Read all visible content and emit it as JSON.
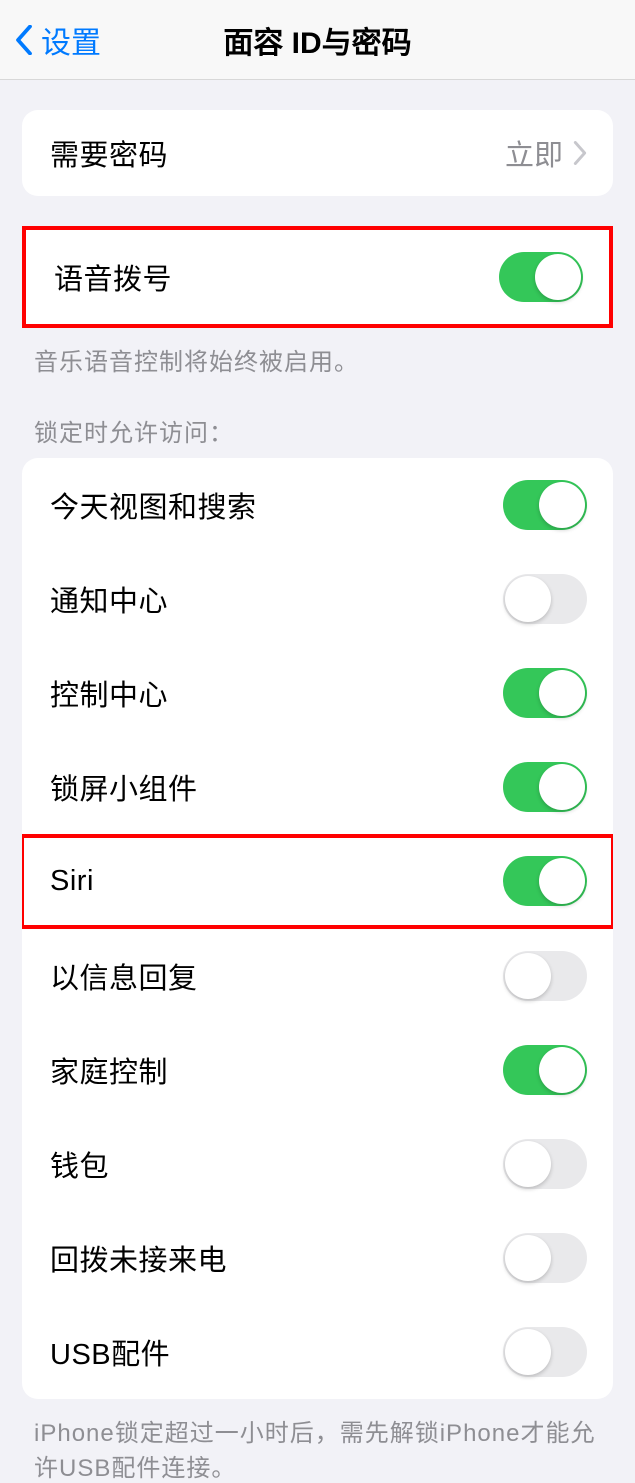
{
  "nav": {
    "back_label": "设置",
    "title": "面容 ID与密码"
  },
  "require_passcode": {
    "label": "需要密码",
    "value": "立即"
  },
  "voice_dial": {
    "label": "语音拨号",
    "enabled": true,
    "footer": "音乐语音控制将始终被启用。"
  },
  "allow_access_header": "锁定时允许访问：",
  "allow_access": [
    {
      "label": "今天视图和搜索",
      "enabled": true
    },
    {
      "label": "通知中心",
      "enabled": false
    },
    {
      "label": "控制中心",
      "enabled": true
    },
    {
      "label": "锁屏小组件",
      "enabled": true
    },
    {
      "label": "Siri",
      "enabled": true,
      "highlighted": true
    },
    {
      "label": "以信息回复",
      "enabled": false
    },
    {
      "label": "家庭控制",
      "enabled": true
    },
    {
      "label": "钱包",
      "enabled": false
    },
    {
      "label": "回拨未接来电",
      "enabled": false
    },
    {
      "label": "USB配件",
      "enabled": false
    }
  ],
  "usb_footer": "iPhone锁定超过一小时后，需先解锁iPhone才能允许USB配件连接。"
}
